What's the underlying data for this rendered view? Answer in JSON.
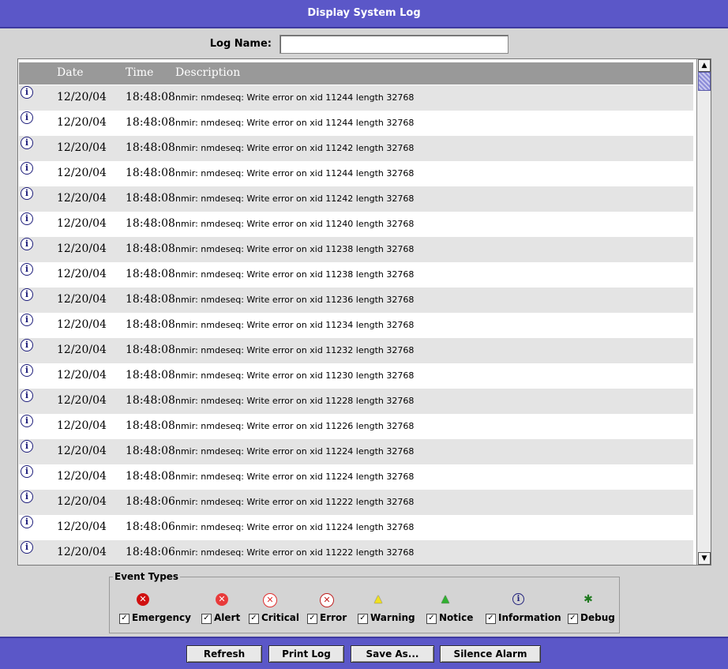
{
  "window": {
    "title": "Display System Log"
  },
  "log_name": {
    "label": "Log Name:",
    "value": ""
  },
  "table": {
    "columns": [
      "Date",
      "Time",
      "Description"
    ],
    "rows": [
      {
        "icon": "information-icon",
        "date": "12/20/04",
        "time": "18:48:08",
        "description": "nmir: nmdeseq: Write error on xid 11244 length 32768"
      },
      {
        "icon": "information-icon",
        "date": "12/20/04",
        "time": "18:48:08",
        "description": "nmir: nmdeseq: Write error on xid 11244 length 32768"
      },
      {
        "icon": "information-icon",
        "date": "12/20/04",
        "time": "18:48:08",
        "description": "nmir: nmdeseq: Write error on xid 11242 length 32768"
      },
      {
        "icon": "information-icon",
        "date": "12/20/04",
        "time": "18:48:08",
        "description": "nmir: nmdeseq: Write error on xid 11244 length 32768"
      },
      {
        "icon": "information-icon",
        "date": "12/20/04",
        "time": "18:48:08",
        "description": "nmir: nmdeseq: Write error on xid 11242 length 32768"
      },
      {
        "icon": "information-icon",
        "date": "12/20/04",
        "time": "18:48:08",
        "description": "nmir: nmdeseq: Write error on xid 11240 length 32768"
      },
      {
        "icon": "information-icon",
        "date": "12/20/04",
        "time": "18:48:08",
        "description": "nmir: nmdeseq: Write error on xid 11238 length 32768"
      },
      {
        "icon": "information-icon",
        "date": "12/20/04",
        "time": "18:48:08",
        "description": "nmir: nmdeseq: Write error on xid 11238 length 32768"
      },
      {
        "icon": "information-icon",
        "date": "12/20/04",
        "time": "18:48:08",
        "description": "nmir: nmdeseq: Write error on xid 11236 length 32768"
      },
      {
        "icon": "information-icon",
        "date": "12/20/04",
        "time": "18:48:08",
        "description": "nmir: nmdeseq: Write error on xid 11234 length 32768"
      },
      {
        "icon": "information-icon",
        "date": "12/20/04",
        "time": "18:48:08",
        "description": "nmir: nmdeseq: Write error on xid 11232 length 32768"
      },
      {
        "icon": "information-icon",
        "date": "12/20/04",
        "time": "18:48:08",
        "description": "nmir: nmdeseq: Write error on xid 11230 length 32768"
      },
      {
        "icon": "information-icon",
        "date": "12/20/04",
        "time": "18:48:08",
        "description": "nmir: nmdeseq: Write error on xid 11228 length 32768"
      },
      {
        "icon": "information-icon",
        "date": "12/20/04",
        "time": "18:48:08",
        "description": "nmir: nmdeseq: Write error on xid 11226 length 32768"
      },
      {
        "icon": "information-icon",
        "date": "12/20/04",
        "time": "18:48:08",
        "description": "nmir: nmdeseq: Write error on xid 11224 length 32768"
      },
      {
        "icon": "information-icon",
        "date": "12/20/04",
        "time": "18:48:08",
        "description": "nmir: nmdeseq: Write error on xid 11224 length 32768"
      },
      {
        "icon": "information-icon",
        "date": "12/20/04",
        "time": "18:48:06",
        "description": "nmir: nmdeseq: Write error on xid 11222 length 32768"
      },
      {
        "icon": "information-icon",
        "date": "12/20/04",
        "time": "18:48:06",
        "description": "nmir: nmdeseq: Write error on xid 11224 length 32768"
      },
      {
        "icon": "information-icon",
        "date": "12/20/04",
        "time": "18:48:06",
        "description": "nmir: nmdeseq: Write error on xid 11222 length 32768"
      }
    ]
  },
  "event_types": {
    "label": "Event Types",
    "items": [
      {
        "label": "Emergency",
        "icon": "emergency-icon",
        "checked": true,
        "color": "#d01010"
      },
      {
        "label": "Alert",
        "icon": "alert-icon",
        "checked": true,
        "color": "#e83a3a"
      },
      {
        "label": "Critical",
        "icon": "critical-icon",
        "checked": true,
        "color": "#e85050"
      },
      {
        "label": "Error",
        "icon": "error-icon",
        "checked": true,
        "color": "#d03030"
      },
      {
        "label": "Warning",
        "icon": "warning-icon",
        "checked": true,
        "color": "#f0e020"
      },
      {
        "label": "Notice",
        "icon": "notice-icon",
        "checked": true,
        "color": "#30b030"
      },
      {
        "label": "Information",
        "icon": "information-icon",
        "checked": true,
        "color": "#1d1d7a"
      },
      {
        "label": "Debug",
        "icon": "debug-bug-icon",
        "checked": true,
        "color": "#207a20"
      }
    ]
  },
  "buttons": {
    "refresh": "Refresh",
    "print_log": "Print Log",
    "save_as": "Save As...",
    "silence_alarm": "Silence Alarm"
  },
  "colors": {
    "title_bar": "#5b57c8",
    "header": "#999999",
    "row_alt": "#e4e4e4"
  }
}
